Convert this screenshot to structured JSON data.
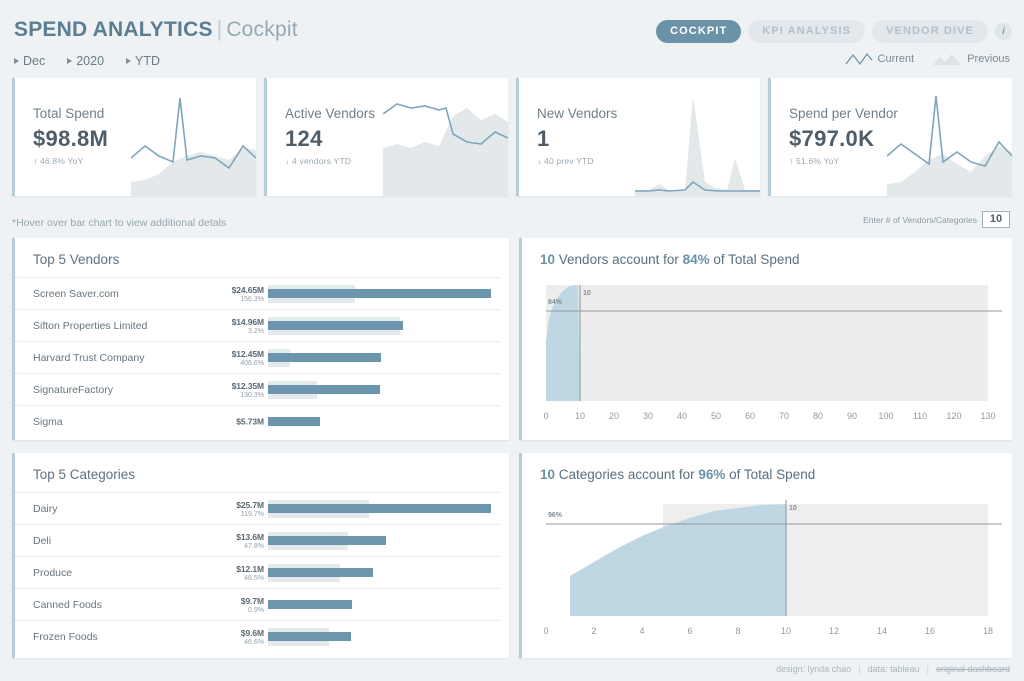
{
  "header": {
    "title_main": "SPEND ANALYTICS",
    "title_sep": "|",
    "title_sub": "Cockpit",
    "filters": [
      {
        "label": "Dec",
        "name": "filter-month"
      },
      {
        "label": "2020",
        "name": "filter-year"
      },
      {
        "label": "YTD",
        "name": "filter-period"
      }
    ],
    "tabs": [
      {
        "label": "COCKPIT",
        "active": true
      },
      {
        "label": "KPI ANALYSIS",
        "active": false
      },
      {
        "label": "VENDOR DIVE",
        "active": false
      }
    ],
    "info_badge": "i",
    "legend": [
      {
        "label": "Current",
        "icon": "line-glyph"
      },
      {
        "label": "Previous",
        "icon": "area-glyph"
      }
    ]
  },
  "kpis": [
    {
      "label": "Total Spend",
      "value": "$98.8M",
      "delta": "↑ 46.8% YoY"
    },
    {
      "label": "Active Vendors",
      "value": "124",
      "delta": "↓ 4 vendors YTD"
    },
    {
      "label": "New Vendors",
      "value": "1",
      "delta": "↓ 40 prev YTD"
    },
    {
      "label": "Spend per Vendor",
      "value": "$797.0K",
      "delta": "↑ 51.6% YoY"
    }
  ],
  "note": "*Hover over bar chart to view additional detals",
  "vendor_input": {
    "label": "Enter # of Vendors/Categories",
    "value": "10"
  },
  "panels": {
    "vendors_title": "Top 5 Vendors",
    "categories_title": "Top 5 Categories"
  },
  "chart_data": [
    {
      "type": "bar",
      "title": "Top 5 Vendors",
      "xlabel": "",
      "ylabel": "",
      "categories": [
        "Screen Saver.com",
        "Sifton Properties Limited",
        "Harvard Trust Company",
        "SignatureFactory",
        "Sigma"
      ],
      "value_labels": [
        "$24.65M",
        "$14.96M",
        "$12.45M",
        "$12.35M",
        "$5.73M"
      ],
      "sub_labels": [
        "156.3%",
        "3.2%",
        "406.6%",
        "130.3%",
        ""
      ],
      "series": [
        {
          "name": "Current",
          "values": [
            24.65,
            14.96,
            12.45,
            12.35,
            5.73
          ]
        },
        {
          "name": "Previous",
          "values": [
            9.62,
            14.49,
            2.46,
            5.36,
            0
          ]
        }
      ]
    },
    {
      "type": "area",
      "title": "10 Vendors account for 84% of Total Spend",
      "title_count": "10",
      "title_pct": "84%",
      "title_mid": " Vendors account for ",
      "title_end": " of Total Spend",
      "xlabel": "",
      "ylabel": "",
      "xlim": [
        0,
        135
      ],
      "ylim": [
        0,
        100
      ],
      "xticks": [
        0,
        10,
        20,
        30,
        40,
        50,
        60,
        70,
        80,
        90,
        100,
        110,
        120,
        130
      ],
      "marker_x": 10,
      "marker_x_label": "10",
      "threshold_pct": 84,
      "threshold_label": "84%",
      "grid": false,
      "legend": "none",
      "cumulative": [
        {
          "x": 0,
          "y": 0
        },
        {
          "x": 1,
          "y": 25
        },
        {
          "x": 2,
          "y": 40
        },
        {
          "x": 3,
          "y": 52
        },
        {
          "x": 4,
          "y": 61
        },
        {
          "x": 5,
          "y": 67
        },
        {
          "x": 6,
          "y": 72
        },
        {
          "x": 7,
          "y": 76
        },
        {
          "x": 8,
          "y": 79
        },
        {
          "x": 9,
          "y": 82
        },
        {
          "x": 10,
          "y": 84
        },
        {
          "x": 20,
          "y": 90
        },
        {
          "x": 30,
          "y": 92
        },
        {
          "x": 40,
          "y": 94
        },
        {
          "x": 60,
          "y": 96
        },
        {
          "x": 90,
          "y": 98
        },
        {
          "x": 130,
          "y": 100
        }
      ]
    },
    {
      "type": "bar",
      "title": "Top 5 Categories",
      "xlabel": "",
      "ylabel": "",
      "categories": [
        "Dairy",
        "Deli",
        "Produce",
        "Canned Foods",
        "Frozen Foods"
      ],
      "value_labels": [
        "$25.7M",
        "$13.6M",
        "$12.1M",
        "$9.7M",
        "$9.6M"
      ],
      "sub_labels": [
        "119.7%",
        "47.8%",
        "46.5%",
        "0.9%",
        "46.6%"
      ],
      "series": [
        {
          "name": "Current",
          "values": [
            25.7,
            13.6,
            12.1,
            9.7,
            9.6
          ]
        },
        {
          "name": "Previous",
          "values": [
            11.7,
            9.2,
            8.25,
            0,
            7.0
          ]
        }
      ]
    },
    {
      "type": "area",
      "title": "10 Categories account for 96% of Total Spend",
      "title_count": "10",
      "title_pct": "96%",
      "title_mid": " Categories account for ",
      "title_end": " of Total Spend",
      "xlabel": "",
      "ylabel": "",
      "xlim": [
        0,
        18
      ],
      "ylim": [
        0,
        100
      ],
      "xticks": [
        0,
        2,
        4,
        6,
        8,
        10,
        12,
        14,
        16,
        18
      ],
      "marker_x": 10,
      "marker_x_label": "10",
      "threshold_pct": 96,
      "threshold_label": "96%",
      "grid": false,
      "legend": "none",
      "cumulative": [
        {
          "x": 1,
          "y": 27
        },
        {
          "x": 2,
          "y": 42
        },
        {
          "x": 3,
          "y": 55
        },
        {
          "x": 4,
          "y": 66
        },
        {
          "x": 5,
          "y": 75
        },
        {
          "x": 6,
          "y": 82
        },
        {
          "x": 7,
          "y": 88
        },
        {
          "x": 8,
          "y": 92
        },
        {
          "x": 9,
          "y": 95
        },
        {
          "x": 10,
          "y": 96
        },
        {
          "x": 11,
          "y": 97
        },
        {
          "x": 17,
          "y": 100
        }
      ]
    }
  ],
  "footer": {
    "design": "design: lynda chao",
    "data": "data: tableau",
    "link": "original dashboard",
    "sep": "|"
  },
  "colors": {
    "accent": "#6b93a8",
    "bar_current": "#6b96ad",
    "bar_previous": "#e4e9ec",
    "area_fill": "#bdd6e2",
    "page_bg": "#eef2f4"
  }
}
